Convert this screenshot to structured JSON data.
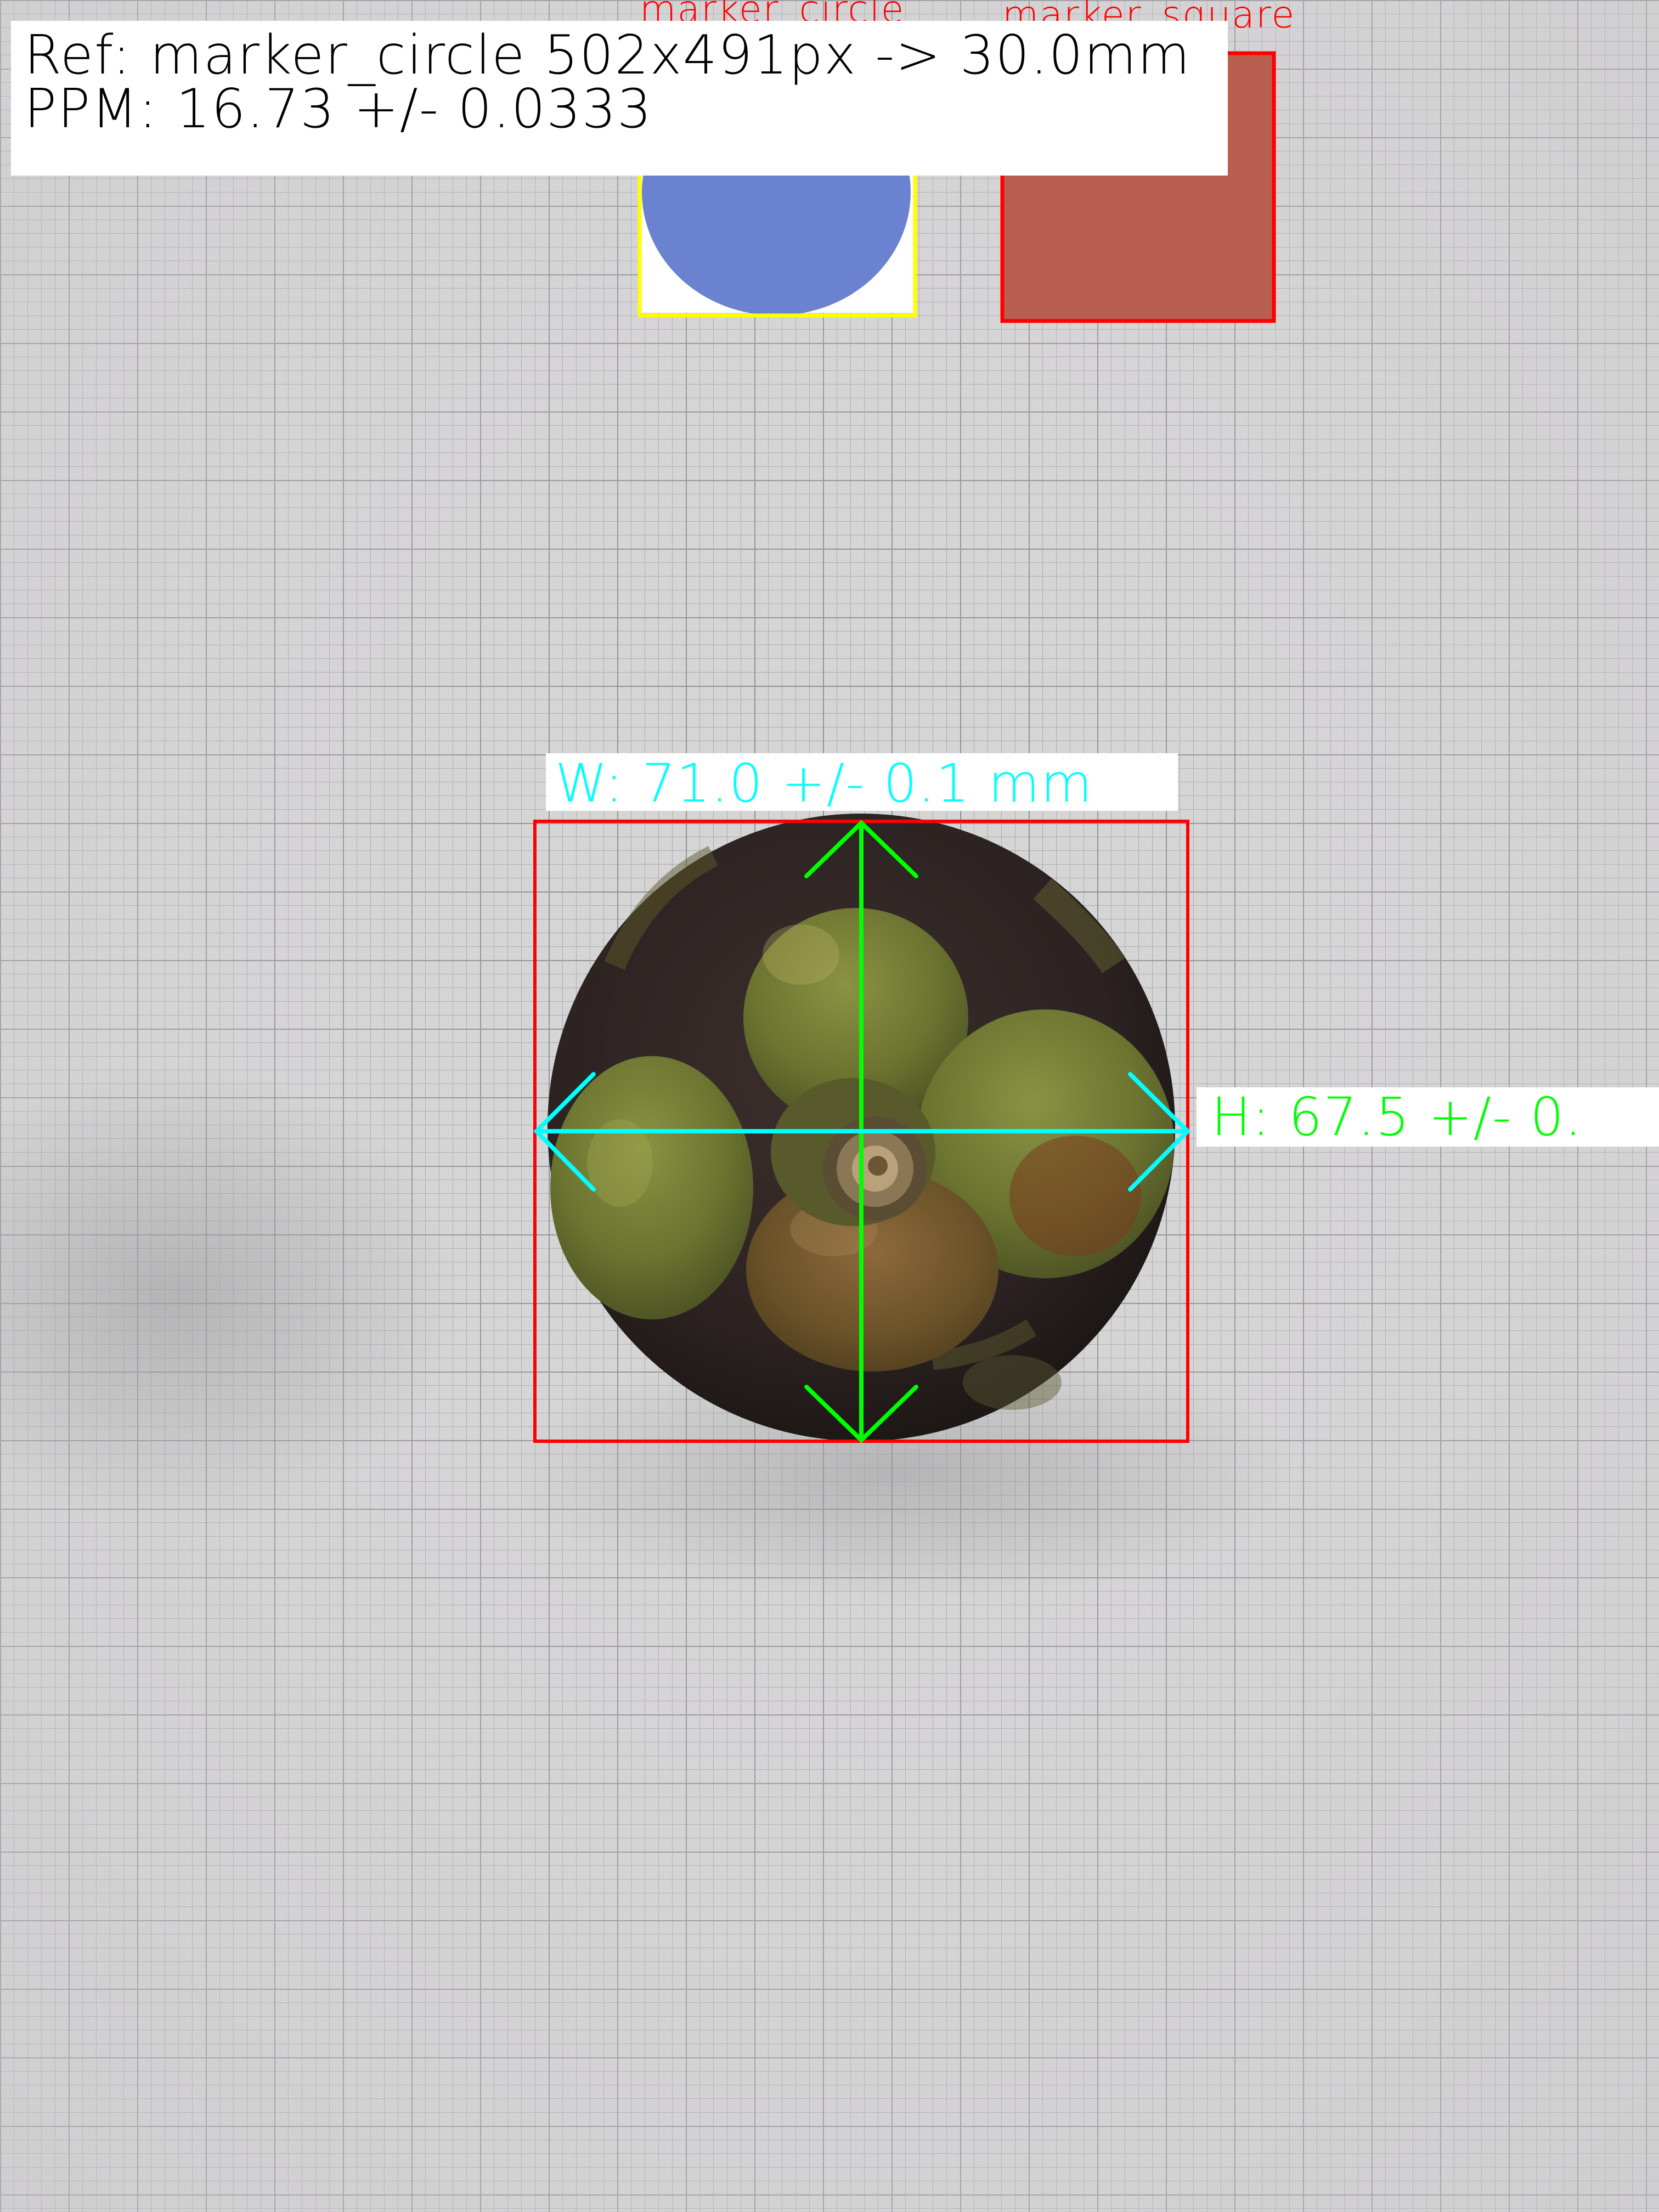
{
  "reference": {
    "line1": "Ref: marker_circle 502x491px -> 30.0mm",
    "line2": "PPM: 16.73 +/- 0.0333"
  },
  "markers": {
    "circle_label": "marker_circle",
    "square_label": "marker_square",
    "circle_fill": "#6a82cf",
    "square_fill": "#b95f4f",
    "circle_outline": "#ffff00",
    "square_outline": "#ff0000"
  },
  "measurement": {
    "width_label": "W: 71.0 +/- 0.1 mm",
    "height_label": "H: 67.5 +/- 0.",
    "width_color": "#00ffff",
    "height_color": "#00ff00",
    "box_color": "#ff0000"
  },
  "paper": {
    "background": "#d6d5d6",
    "grid_color": "#9a9aa0"
  },
  "fruit": {
    "rind": "#2f2524",
    "calyx": "#7c8339"
  }
}
